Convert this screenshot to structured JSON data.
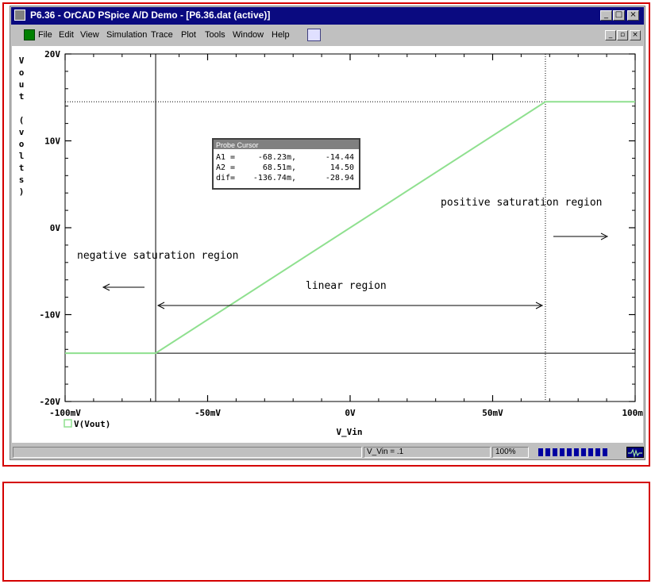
{
  "window": {
    "title": "P6.36 - OrCAD PSpice A/D Demo - [P6.36.dat (active)]"
  },
  "menu": {
    "items": [
      "File",
      "Edit",
      "View",
      "Simulation",
      "Trace",
      "Plot",
      "Tools",
      "Window",
      "Help"
    ]
  },
  "colors": {
    "trace": "#8fe08f",
    "frame": "#d40000",
    "titlebar": "#0a0a80",
    "progress": "#0000a0"
  },
  "plot": {
    "y_axis_label": "Vout (volts)",
    "y_axis_label_chars": [
      "V",
      "o",
      "u",
      "t",
      "",
      "(",
      "v",
      "o",
      "l",
      "t",
      "s",
      ")"
    ],
    "x_axis_label": "V_Vin",
    "legend": "V(Vout)",
    "annotations": {
      "positive": "positive saturation region",
      "negative": "negative saturation region",
      "linear": "linear region"
    },
    "probe_cursor": {
      "title": "Probe Cursor",
      "rows": [
        {
          "label": "A1 =",
          "x": "-68.23m,",
          "y": "-14.44"
        },
        {
          "label": "A2 =",
          "x": "68.51m,",
          "y": "14.50"
        },
        {
          "label": "dif=",
          "x": "-136.74m,",
          "y": "-28.94"
        }
      ]
    }
  },
  "chart_data": {
    "type": "line",
    "xlabel": "V_Vin",
    "ylabel": "Vout (volts)",
    "xlim": [
      -100,
      100
    ],
    "ylim": [
      -20,
      20
    ],
    "x_unit": "mV",
    "y_unit": "V",
    "x_ticks": [
      "-100mV",
      "-50mV",
      "0V",
      "50mV",
      "100mV"
    ],
    "x_tick_values": [
      -100,
      -50,
      0,
      50,
      100
    ],
    "y_ticks": [
      "20V",
      "10V",
      "0V",
      "-10V",
      "-20V"
    ],
    "y_tick_values": [
      20,
      10,
      0,
      -10,
      -20
    ],
    "series": [
      {
        "name": "V(Vout)",
        "x": [
          -100,
          -68.23,
          68.51,
          100
        ],
        "y": [
          -14.44,
          -14.44,
          14.5,
          14.5
        ]
      }
    ],
    "cursors": [
      {
        "x": -68.23,
        "y": -14.44
      },
      {
        "x": 68.51,
        "y": 14.5
      }
    ],
    "grid": false,
    "legend_position": "bottom-left"
  },
  "status": {
    "cursor_value": "V_Vin = .1",
    "zoom": "100%",
    "progress_segments": 10
  }
}
